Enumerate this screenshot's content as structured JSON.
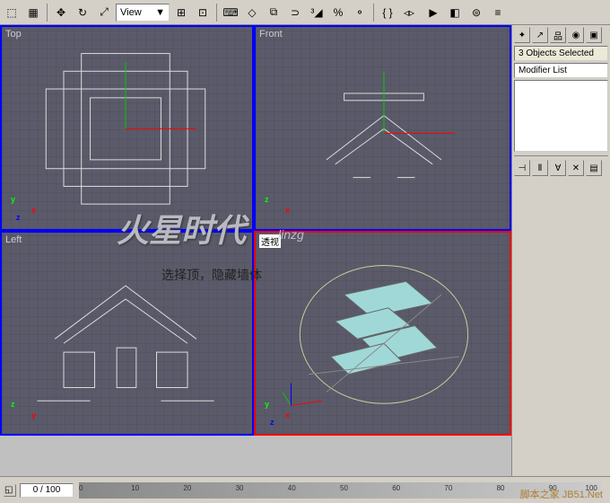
{
  "toolbar": {
    "view_dropdown": "View",
    "arrow": "▼"
  },
  "viewports": {
    "top_left": "Top",
    "top_right": "Front",
    "bottom_left": "Left",
    "bottom_right": "透视"
  },
  "side_panel": {
    "selection_status": "3 Objects Selected",
    "modifier_list": "Modifier List"
  },
  "timeline": {
    "frame": "0 / 100",
    "ticks": [
      "0",
      "10",
      "20",
      "30",
      "40",
      "50",
      "60",
      "70",
      "80",
      "90",
      "100"
    ]
  },
  "watermark": {
    "main": "火星时代",
    "sub": "linzg",
    "instruction": "选择顶，隐藏墙体",
    "footer": "脚本之家 JB51.Net"
  },
  "axis": {
    "x": "x",
    "y": "y",
    "z": "z"
  }
}
